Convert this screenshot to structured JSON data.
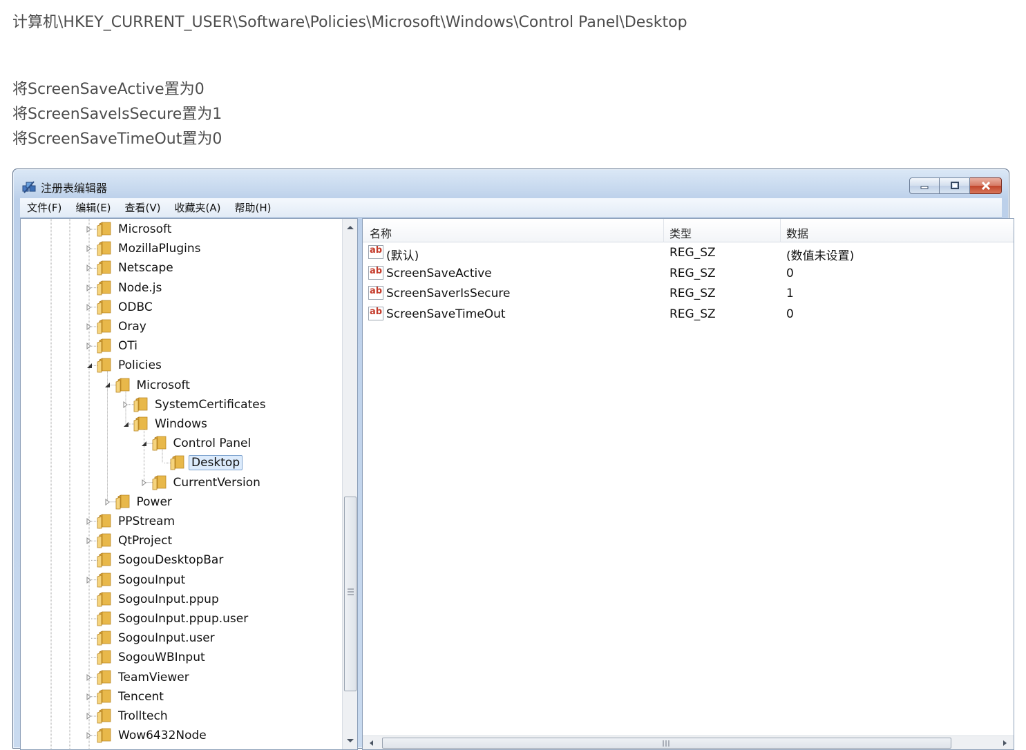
{
  "article": {
    "path_line": "计算机\\HKEY_CURRENT_USER\\Software\\Policies\\Microsoft\\Windows\\Control Panel\\Desktop",
    "steps": [
      "将ScreenSaveActive置为0",
      "将ScreenSaveIsSecure置为1",
      "将ScreenSaveTimeOut置为0"
    ]
  },
  "window": {
    "title": "注册表编辑器",
    "app_icon": "regedit-icon",
    "controls": [
      "minimize",
      "maximize",
      "close"
    ]
  },
  "menu": [
    "文件(F)",
    "编辑(E)",
    "查看(V)",
    "收藏夹(A)",
    "帮助(H)"
  ],
  "tree": {
    "selected": "Desktop",
    "rows": [
      {
        "label": "Microsoft",
        "depth": 0,
        "state": "collapsed"
      },
      {
        "label": "MozillaPlugins",
        "depth": 0,
        "state": "collapsed"
      },
      {
        "label": "Netscape",
        "depth": 0,
        "state": "collapsed"
      },
      {
        "label": "Node.js",
        "depth": 0,
        "state": "collapsed"
      },
      {
        "label": "ODBC",
        "depth": 0,
        "state": "collapsed"
      },
      {
        "label": "Oray",
        "depth": 0,
        "state": "collapsed"
      },
      {
        "label": "OTi",
        "depth": 0,
        "state": "collapsed"
      },
      {
        "label": "Policies",
        "depth": 0,
        "state": "expanded"
      },
      {
        "label": "Microsoft",
        "depth": 1,
        "state": "expanded"
      },
      {
        "label": "SystemCertificates",
        "depth": 2,
        "state": "collapsed"
      },
      {
        "label": "Windows",
        "depth": 2,
        "state": "expanded"
      },
      {
        "label": "Control Panel",
        "depth": 3,
        "state": "expanded"
      },
      {
        "label": "Desktop",
        "depth": 4,
        "state": "leaf"
      },
      {
        "label": "CurrentVersion",
        "depth": 3,
        "state": "collapsed"
      },
      {
        "label": "Power",
        "depth": 1,
        "state": "collapsed"
      },
      {
        "label": "PPStream",
        "depth": 0,
        "state": "collapsed"
      },
      {
        "label": "QtProject",
        "depth": 0,
        "state": "collapsed"
      },
      {
        "label": "SogouDesktopBar",
        "depth": 0,
        "state": "leaf"
      },
      {
        "label": "SogouInput",
        "depth": 0,
        "state": "collapsed"
      },
      {
        "label": "SogouInput.ppup",
        "depth": 0,
        "state": "leaf"
      },
      {
        "label": "SogouInput.ppup.user",
        "depth": 0,
        "state": "leaf"
      },
      {
        "label": "SogouInput.user",
        "depth": 0,
        "state": "leaf"
      },
      {
        "label": "SogouWBInput",
        "depth": 0,
        "state": "leaf"
      },
      {
        "label": "TeamViewer",
        "depth": 0,
        "state": "collapsed"
      },
      {
        "label": "Tencent",
        "depth": 0,
        "state": "collapsed"
      },
      {
        "label": "Trolltech",
        "depth": 0,
        "state": "collapsed"
      },
      {
        "label": "Wow6432Node",
        "depth": 0,
        "state": "collapsed"
      }
    ]
  },
  "list": {
    "columns": [
      "名称",
      "类型",
      "数据"
    ],
    "value_icon": "ab",
    "rows": [
      {
        "name": "(默认)",
        "type": "REG_SZ",
        "data": "(数值未设置)"
      },
      {
        "name": "ScreenSaveActive",
        "type": "REG_SZ",
        "data": "0"
      },
      {
        "name": "ScreenSaverIsSecure",
        "type": "REG_SZ",
        "data": "1"
      },
      {
        "name": "ScreenSaveTimeOut",
        "type": "REG_SZ",
        "data": "0"
      }
    ]
  },
  "colors": {
    "selection_bg": "#dcebfc",
    "folder": "#e8b84a",
    "ab_icon": "#c43b2b"
  }
}
